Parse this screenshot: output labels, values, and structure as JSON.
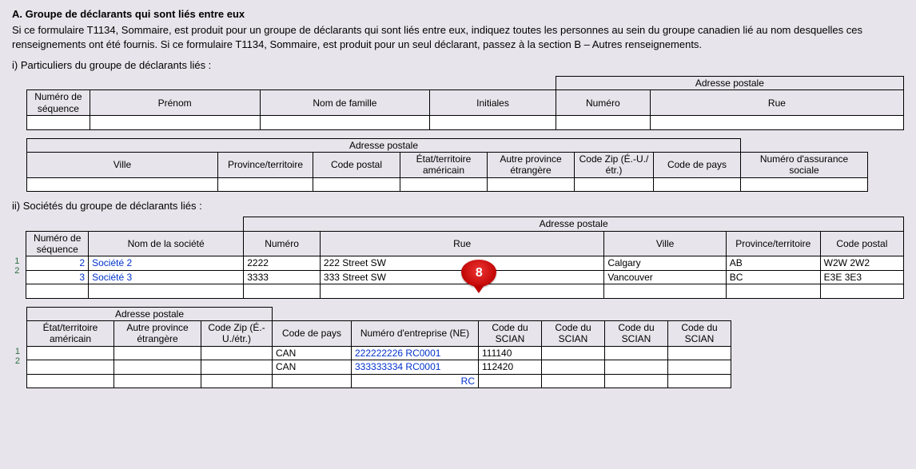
{
  "section": {
    "title": "A. Groupe de déclarants qui sont liés entre eux",
    "intro": "Si ce formulaire T1134, Sommaire, est produit pour un groupe de déclarants qui sont liés entre eux, indiquez toutes les personnes au sein du groupe canadien lié au nom desquelles ces renseignements ont été fournis. Si ce formulaire T1134, Sommaire, est produit pour un seul déclarant, passez à la section B – Autres renseignements."
  },
  "part_i": {
    "heading": "i) Particuliers du groupe de déclarants liés :",
    "t1": {
      "adresse_postale": "Adresse postale",
      "num_seq": "Numéro de séquence",
      "prenom": "Prénom",
      "nom_famille": "Nom de famille",
      "initiales": "Initiales",
      "numero": "Numéro",
      "rue": "Rue"
    },
    "t2": {
      "adresse_postale": "Adresse postale",
      "ville": "Ville",
      "prov": "Province/territoire",
      "code_postal": "Code postal",
      "etat_us": "État/territoire américain",
      "autre_prov": "Autre province étrangère",
      "code_zip": "Code Zip (É.-U./étr.)",
      "code_pays": "Code de pays",
      "nas": "Numéro d'assurance sociale"
    }
  },
  "part_ii": {
    "heading": "ii) Sociétés du groupe de déclarants liés :",
    "t1": {
      "adresse_postale": "Adresse postale",
      "num_seq": "Numéro de séquence",
      "nom_societe": "Nom de la société",
      "numero": "Numéro",
      "rue": "Rue",
      "ville": "Ville",
      "prov": "Province/territoire",
      "code_postal": "Code postal",
      "rows": [
        {
          "idx": "1",
          "seq": "2",
          "nom": "Société 2",
          "num": "2222",
          "rue": "222 Street SW",
          "ville": "Calgary",
          "prov": "AB",
          "cp": "W2W 2W2"
        },
        {
          "idx": "2",
          "seq": "3",
          "nom": "Société 3",
          "num": "3333",
          "rue": "333 Street SW",
          "ville": "Vancouver",
          "prov": "BC",
          "cp": "E3E 3E3"
        }
      ]
    },
    "t2": {
      "adresse_postale": "Adresse postale",
      "etat_us": "État/territoire américain",
      "autre_prov": "Autre province étrangère",
      "code_zip": "Code Zip (É.-U./étr.)",
      "code_pays": "Code de pays",
      "ne": "Numéro d'entreprise (NE)",
      "scian": "Code du SCIAN",
      "rows": [
        {
          "idx": "1",
          "pays": "CAN",
          "ne": "222222226 RC0001",
          "sc1": "111140"
        },
        {
          "idx": "2",
          "pays": "CAN",
          "ne": "333333334 RC0001",
          "sc1": "112420"
        }
      ],
      "rc": "RC"
    }
  },
  "marker": "8"
}
